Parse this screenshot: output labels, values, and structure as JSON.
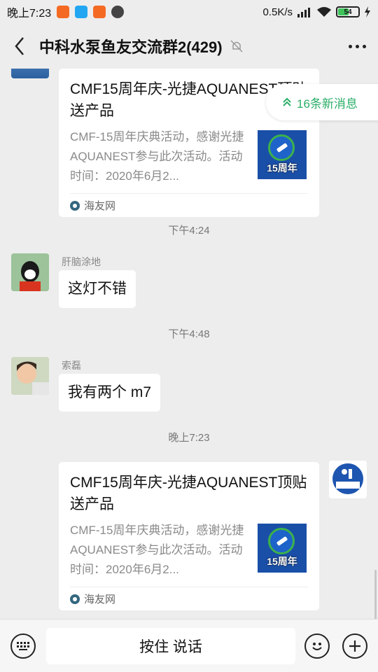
{
  "status_bar": {
    "time": "晚上7:23",
    "network_speed": "0.5K/s",
    "battery": "54",
    "battery_level": 0.54
  },
  "header": {
    "title": "中科水泵鱼友交流群2(429)"
  },
  "new_messages": "16条新消息",
  "messages": {
    "card1": {
      "title": "CMF15周年庆-光捷AQUANEST顶贴送产品",
      "desc": "CMF-15周年庆典活动，感谢光捷AQUANEST参与此次活动。活动时间：2020年6月2...",
      "thumb_text": "15周年",
      "source": "海友网"
    },
    "ts1": "下午4:24",
    "msg1": {
      "sender": "肝脑涂地",
      "text": "这灯不错"
    },
    "ts2": "下午4:48",
    "msg2": {
      "sender": "索磊",
      "text": "我有两个 m7"
    },
    "ts3": "晚上7:23",
    "card2": {
      "title": "CMF15周年庆-光捷AQUANEST顶贴送产品",
      "desc": "CMF-15周年庆典活动，感谢光捷AQUANEST参与此次活动。活动时间：2020年6月2...",
      "thumb_text": "15周年",
      "source": "海友网"
    }
  },
  "input_bar": {
    "press_to_talk": "按住 说话"
  },
  "colors": {
    "background": "#ededed",
    "accent_green": "#2aae67"
  }
}
